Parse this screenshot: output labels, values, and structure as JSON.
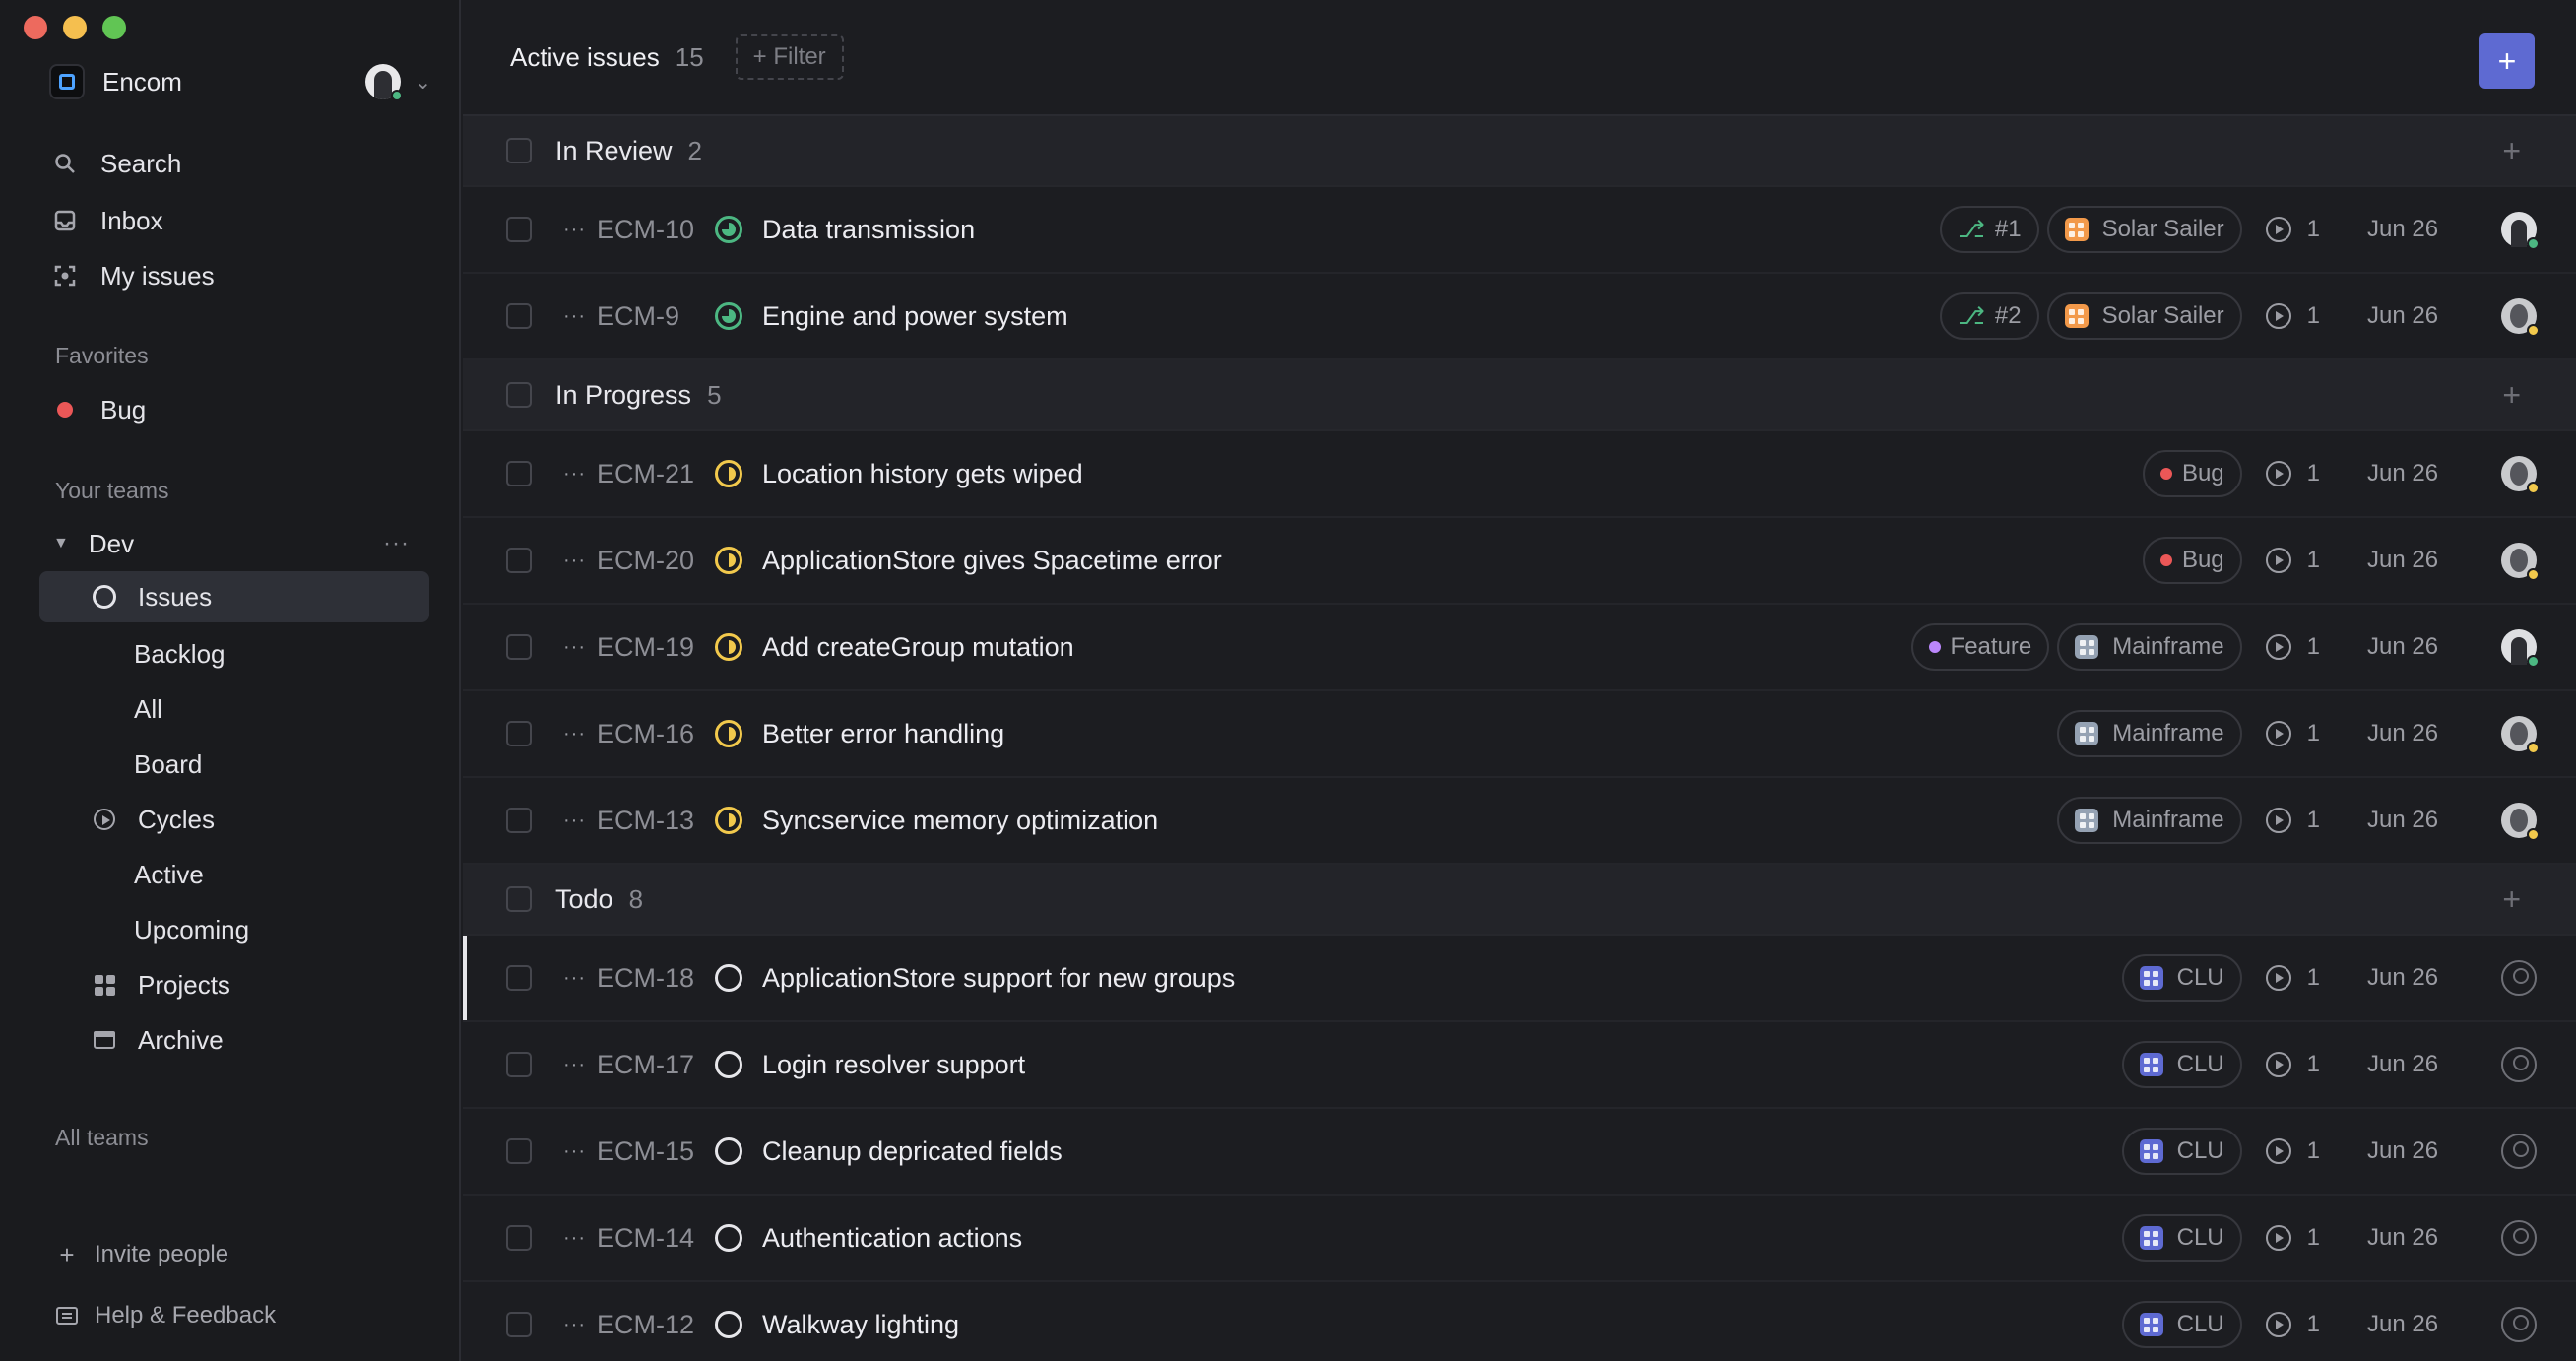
{
  "window": {
    "controls": [
      "close",
      "minimize",
      "maximize"
    ]
  },
  "sidebar": {
    "workspace": {
      "name": "Encom"
    },
    "nav": [
      {
        "label": "Search",
        "icon": "search-icon"
      },
      {
        "label": "Inbox",
        "icon": "inbox-icon"
      },
      {
        "label": "My issues",
        "icon": "my-issues-icon"
      }
    ],
    "favorites_label": "Favorites",
    "favorites": [
      {
        "label": "Bug",
        "color": "#eb5757"
      }
    ],
    "teams_label": "Your teams",
    "team": {
      "name": "Dev",
      "items": [
        {
          "label": "Issues",
          "icon": "issues-icon",
          "active": true
        },
        {
          "label": "Backlog"
        },
        {
          "label": "All"
        },
        {
          "label": "Board"
        },
        {
          "label": "Cycles",
          "icon": "cycles-icon"
        },
        {
          "label": "Active"
        },
        {
          "label": "Upcoming"
        },
        {
          "label": "Projects",
          "icon": "projects-icon"
        },
        {
          "label": "Archive",
          "icon": "archive-icon"
        }
      ]
    },
    "all_teams_label": "All teams",
    "invite_label": "Invite people",
    "help_label": "Help & Feedback"
  },
  "header": {
    "title": "Active issues",
    "count": "15",
    "filter_label": "+ Filter",
    "new_issue_label": "+"
  },
  "colors": {
    "accent": "#5e6ad2",
    "in_review": "#4cb782",
    "in_progress": "#f2c94c",
    "bug": "#eb5757",
    "feature": "#bb87fc",
    "solar_sailer": "#f2994a",
    "mainframe": "#95a2b3",
    "clu": "#5e6ad2"
  },
  "groups": [
    {
      "name": "In Review",
      "count": "2",
      "status": "review",
      "issues": [
        {
          "id": "ECM-10",
          "title": "Data transmission",
          "pr": "#1",
          "labels": [],
          "project": "Solar Sailer",
          "cycle": "1",
          "date": "Jun 26",
          "assignee": "photo",
          "assignee_status": "online"
        },
        {
          "id": "ECM-9",
          "title": "Engine and power system",
          "pr": "#2",
          "labels": [],
          "project": "Solar Sailer",
          "cycle": "1",
          "date": "Jun 26",
          "assignee": "photo2",
          "assignee_status": "away"
        }
      ]
    },
    {
      "name": "In Progress",
      "count": "5",
      "status": "progress",
      "issues": [
        {
          "id": "ECM-21",
          "title": "Location history gets wiped",
          "labels": [
            "Bug"
          ],
          "project": "",
          "cycle": "1",
          "date": "Jun 26",
          "assignee": "photo2",
          "assignee_status": "away"
        },
        {
          "id": "ECM-20",
          "title": "ApplicationStore gives Spacetime error",
          "labels": [
            "Bug"
          ],
          "project": "",
          "cycle": "1",
          "date": "Jun 26",
          "assignee": "photo2",
          "assignee_status": "away"
        },
        {
          "id": "ECM-19",
          "title": "Add createGroup mutation",
          "labels": [
            "Feature"
          ],
          "project": "Mainframe",
          "cycle": "1",
          "date": "Jun 26",
          "assignee": "photo",
          "assignee_status": "online"
        },
        {
          "id": "ECM-16",
          "title": "Better error handling",
          "labels": [],
          "project": "Mainframe",
          "cycle": "1",
          "date": "Jun 26",
          "assignee": "photo2",
          "assignee_status": "away"
        },
        {
          "id": "ECM-13",
          "title": "Syncservice memory optimization",
          "labels": [],
          "project": "Mainframe",
          "cycle": "1",
          "date": "Jun 26",
          "assignee": "photo2",
          "assignee_status": "away"
        }
      ]
    },
    {
      "name": "Todo",
      "count": "8",
      "status": "todo",
      "issues": [
        {
          "id": "ECM-18",
          "title": "ApplicationStore support for new groups",
          "labels": [],
          "project": "CLU",
          "cycle": "1",
          "date": "Jun 26",
          "assignee": "none",
          "selected": true
        },
        {
          "id": "ECM-17",
          "title": "Login resolver support",
          "labels": [],
          "project": "CLU",
          "cycle": "1",
          "date": "Jun 26",
          "assignee": "none"
        },
        {
          "id": "ECM-15",
          "title": "Cleanup depricated fields",
          "labels": [],
          "project": "CLU",
          "cycle": "1",
          "date": "Jun 26",
          "assignee": "none"
        },
        {
          "id": "ECM-14",
          "title": "Authentication actions",
          "labels": [],
          "project": "CLU",
          "cycle": "1",
          "date": "Jun 26",
          "assignee": "none"
        },
        {
          "id": "ECM-12",
          "title": "Walkway lighting",
          "labels": [],
          "project": "CLU",
          "cycle": "1",
          "date": "Jun 26",
          "assignee": "none"
        }
      ]
    }
  ]
}
